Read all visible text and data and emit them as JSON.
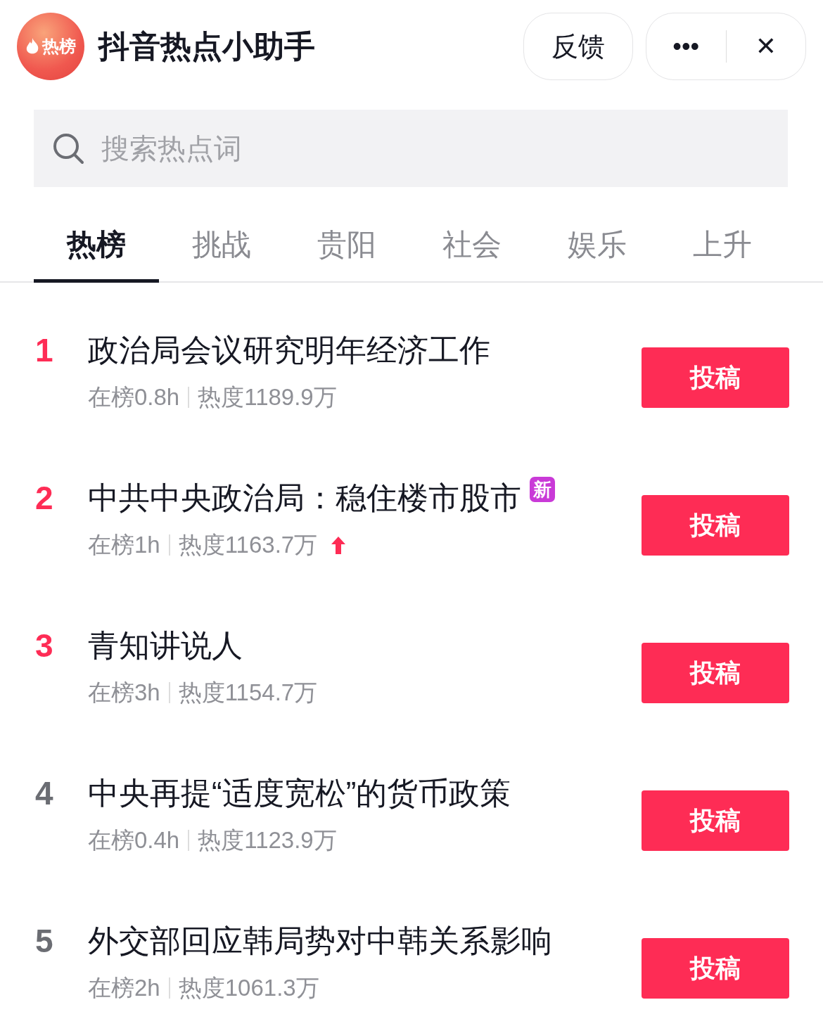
{
  "header": {
    "logo_text": "热榜",
    "title": "抖音热点小助手",
    "feedback_button": "反馈",
    "more_button": "•••",
    "close_button": "✕"
  },
  "search": {
    "placeholder": "搜索热点词"
  },
  "tabs": [
    {
      "label": "热榜",
      "selected": true
    },
    {
      "label": "挑战",
      "selected": false
    },
    {
      "label": "贵阳",
      "selected": false
    },
    {
      "label": "社会",
      "selected": false
    },
    {
      "label": "娱乐",
      "selected": false
    },
    {
      "label": "上升",
      "selected": false
    }
  ],
  "items": [
    {
      "rank": "1",
      "color": "#fe2c55",
      "title": "政治局会议研究明年经济工作",
      "time": "在榜0.8h",
      "heat": "热度1189.9万",
      "rising": false,
      "action": "投稿"
    },
    {
      "rank": "2",
      "color": "#fe2c55",
      "title": "中共中央政治局：稳住楼市股市",
      "badge": "新",
      "time": "在榜1h",
      "heat": "热度1163.7万",
      "rising": true,
      "action": "投稿"
    },
    {
      "rank": "3",
      "color": "#fe2c55",
      "title": "青知讲说人",
      "time": "在榜3h",
      "heat": "热度1154.7万",
      "rising": false,
      "action": "投稿"
    },
    {
      "rank": "4",
      "color": "#6b6d73",
      "title": "中央再提“适度宽松”的货币政策",
      "time": "在榜0.4h",
      "heat": "热度1123.9万",
      "rising": false,
      "action": "投稿"
    },
    {
      "rank": "5",
      "color": "#6b6d73",
      "title": "外交部回应韩局势对中韩关系影响",
      "time": "在榜2h",
      "heat": "热度1061.3万",
      "rising": false,
      "action": "投稿"
    }
  ]
}
